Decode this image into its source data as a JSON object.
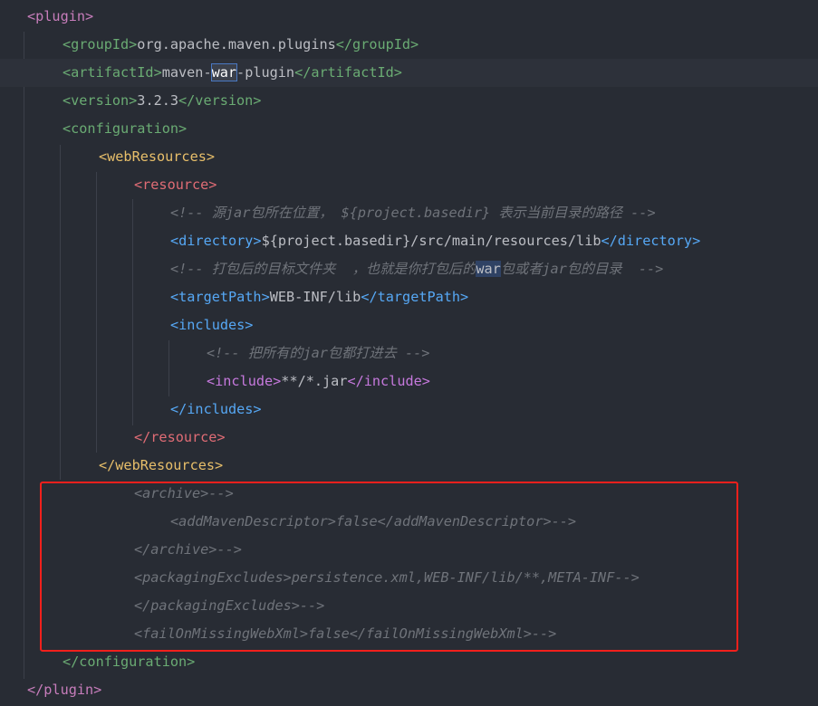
{
  "lines": [
    {
      "indent": 0,
      "segs": [
        {
          "t": "<plugin>",
          "c": "purple"
        }
      ]
    },
    {
      "indent": 1,
      "segs": [
        {
          "t": "<groupId>",
          "c": "green"
        },
        {
          "t": "org.apache.maven.plugins",
          "c": "text"
        },
        {
          "t": "</groupId>",
          "c": "green"
        }
      ]
    },
    {
      "indent": 1,
      "current": true,
      "segs": [
        {
          "t": "<artifactId>",
          "c": "green"
        },
        {
          "t": "maven-",
          "c": "text"
        },
        {
          "t": "war",
          "c": "sel"
        },
        {
          "t": "-plugin",
          "c": "text"
        },
        {
          "t": "</artifactId>",
          "c": "green"
        }
      ]
    },
    {
      "indent": 1,
      "segs": [
        {
          "t": "<version>",
          "c": "green"
        },
        {
          "t": "3.2.3",
          "c": "text"
        },
        {
          "t": "</version>",
          "c": "green"
        }
      ]
    },
    {
      "indent": 1,
      "segs": [
        {
          "t": "<configuration>",
          "c": "green"
        }
      ]
    },
    {
      "indent": 2,
      "segs": [
        {
          "t": "<webResources>",
          "c": "orange"
        }
      ]
    },
    {
      "indent": 3,
      "segs": [
        {
          "t": "<resource>",
          "c": "red"
        }
      ]
    },
    {
      "indent": 4,
      "segs": [
        {
          "t": "<!-- 源jar包所在位置， ${project.basedir} 表示当前目录的路径 -->",
          "c": "comment"
        }
      ]
    },
    {
      "indent": 4,
      "segs": [
        {
          "t": "<directory>",
          "c": "blue"
        },
        {
          "t": "${project.basedir}/src/main/resources/lib",
          "c": "text"
        },
        {
          "t": "</directory>",
          "c": "blue"
        }
      ]
    },
    {
      "indent": 4,
      "segs": [
        {
          "t": "<!-- 打包后的目标文件夹  ，也就是你打包后的",
          "c": "comment"
        },
        {
          "t": "war",
          "c": "hl"
        },
        {
          "t": "包或者jar包的目录  -->",
          "c": "comment"
        }
      ]
    },
    {
      "indent": 4,
      "segs": [
        {
          "t": "<targetPath>",
          "c": "blue"
        },
        {
          "t": "WEB-INF/lib",
          "c": "text"
        },
        {
          "t": "</targetPath>",
          "c": "blue"
        }
      ]
    },
    {
      "indent": 4,
      "segs": [
        {
          "t": "<includes>",
          "c": "blue"
        }
      ]
    },
    {
      "indent": 5,
      "segs": [
        {
          "t": "<!-- 把所有的jar包都打进去 -->",
          "c": "comment"
        }
      ]
    },
    {
      "indent": 5,
      "segs": [
        {
          "t": "<include>",
          "c": "violet"
        },
        {
          "t": "**/*.jar",
          "c": "text"
        },
        {
          "t": "</include>",
          "c": "violet"
        }
      ]
    },
    {
      "indent": 4,
      "segs": [
        {
          "t": "</includes>",
          "c": "blue"
        }
      ]
    },
    {
      "indent": 3,
      "segs": [
        {
          "t": "</resource>",
          "c": "red"
        }
      ]
    },
    {
      "indent": 2,
      "segs": [
        {
          "t": "</webResources>",
          "c": "orange"
        }
      ]
    },
    {
      "indent": 3,
      "segs": [
        {
          "t": "<archive>-->",
          "c": "comment"
        }
      ]
    },
    {
      "indent": 4,
      "segs": [
        {
          "t": "<addMavenDescriptor>false</addMavenDescriptor>-->",
          "c": "comment"
        }
      ]
    },
    {
      "indent": 3,
      "segs": [
        {
          "t": "</archive>-->",
          "c": "comment"
        }
      ]
    },
    {
      "indent": 3,
      "segs": [
        {
          "t": "<packagingExcludes>persistence.xml,WEB-INF/lib/**,META-INF-->",
          "c": "comment"
        }
      ]
    },
    {
      "indent": 3,
      "segs": [
        {
          "t": "</packagingExcludes>-->",
          "c": "comment"
        }
      ]
    },
    {
      "indent": 3,
      "segs": [
        {
          "t": "<failOnMissingWebXml>false</failOnMissingWebXml>-->",
          "c": "comment"
        }
      ]
    },
    {
      "indent": 1,
      "segs": [
        {
          "t": "</configuration>",
          "c": "green"
        }
      ]
    },
    {
      "indent": 0,
      "segs": [
        {
          "t": "</plugin>",
          "c": "purple"
        }
      ]
    }
  ]
}
